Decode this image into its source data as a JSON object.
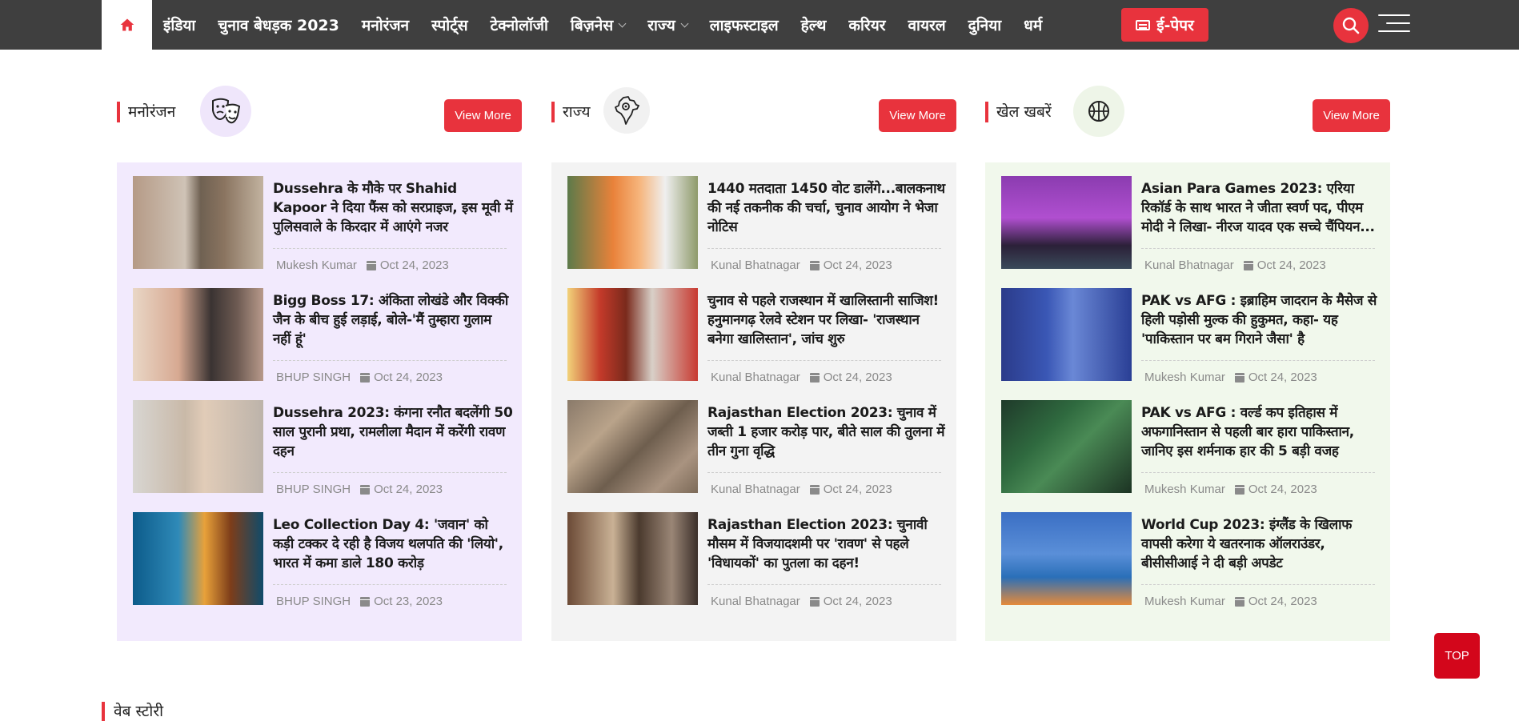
{
  "nav": {
    "items": [
      "इंडिया",
      "चुनाव बेधड़क 2023",
      "मनोरंजन",
      "स्पोर्ट्स",
      "टेक्नोलॉजी",
      "बिज़नेस",
      "राज्य",
      "लाइफस्टाइल",
      "हेल्थ",
      "करियर",
      "वायरल",
      "दुनिया",
      "धर्म"
    ],
    "dropdown_items": [
      "बिज़नेस",
      "राज्य"
    ],
    "epaper_label": "ई-पेपर",
    "accent_color": "#e8333d",
    "bar_color": "#3f3f3f"
  },
  "sections": [
    {
      "title": "मनोरंजन",
      "icon": "theater-masks-icon",
      "view_more": "View More",
      "stories": [
        {
          "headline": "Dussehra के मौके पर Shahid Kapoor ने दिया फैंस को सरप्राइज, इस मूवी में पुलिसवाले के किरदार में आएंगे नजर",
          "author": "Mukesh Kumar",
          "date": "Oct 24, 2023"
        },
        {
          "headline": "Bigg Boss 17: अंकिता लोखंडे और विक्की जैन के बीच हुई लड़ाई, बोले-'मैं तुम्हारा गुलाम नहीं हूं'",
          "author": "BHUP SINGH",
          "date": "Oct 24, 2023"
        },
        {
          "headline": "Dussehra 2023: कंगना रनौत बदलेंगी 50 साल पुरानी प्रथा, रामलीला मैदान में करेंगी रावण दहन",
          "author": "BHUP SINGH",
          "date": "Oct 24, 2023"
        },
        {
          "headline": "Leo Collection Day 4: 'जवान' को कड़ी टक्कर दे रही है विजय थलपति की 'लियो', भारत में कमा डाले 180 करोड़",
          "author": "BHUP SINGH",
          "date": "Oct 23, 2023"
        }
      ]
    },
    {
      "title": "राज्य",
      "icon": "india-map-icon",
      "view_more": "View More",
      "stories": [
        {
          "headline": "1440 मतदाता 1450 वोट डालेंगे...बालकनाथ की नई तकनीक की चर्चा, चुनाव आयोग ने भेजा नोटिस",
          "author": "Kunal Bhatnagar",
          "date": "Oct 24, 2023"
        },
        {
          "headline": "चुनाव से पहले राजस्थान में खालिस्तानी साजिश! हनुमानगढ़ रेलवे स्टेशन पर लिखा- 'राजस्थान बनेगा खालिस्तान', जांच शुरु",
          "author": "Kunal Bhatnagar",
          "date": "Oct 24, 2023"
        },
        {
          "headline": "Rajasthan Election 2023: चुनाव में जब्ती 1 हजार करोड़ पार, बीते साल की तुलना में तीन गुना वृद्धि",
          "author": "Kunal Bhatnagar",
          "date": "Oct 24, 2023"
        },
        {
          "headline": "Rajasthan Election 2023: चुनावी मौसम में विजयादशमी पर 'रावण' से पहले 'विधायकों' का पुतला का दहन!",
          "author": "Kunal Bhatnagar",
          "date": "Oct 24, 2023"
        }
      ]
    },
    {
      "title": "खेल खबरें",
      "icon": "basketball-icon",
      "view_more": "View More",
      "stories": [
        {
          "headline": "Asian Para Games 2023: एरिया रिकॉर्ड के साथ भारत ने जीता स्वर्ण पद, पीएम मोदी ने लिखा- नीरज यादव एक सच्चे चैंपियन...",
          "author": "Kunal Bhatnagar",
          "date": "Oct 24, 2023"
        },
        {
          "headline": "PAK vs AFG : इब्राहिम जादरान के मैसेज से हिली पड़ोसी मुल्क की हुकुमत, कहा- यह 'पाकिस्तान पर बम गिराने जैसा' है",
          "author": "Mukesh Kumar",
          "date": "Oct 24, 2023"
        },
        {
          "headline": "PAK vs AFG : वर्ल्ड कप इतिहास में अफगानिस्तान से पहली बार हारा पाकिस्तान, जानिए इस शर्मनाक हार की 5 बड़ी वजह",
          "author": "Mukesh Kumar",
          "date": "Oct 24, 2023"
        },
        {
          "headline": "World Cup 2023: इंग्लैंड के खिलाफ वापसी करेगा ये खतरनाक ऑलराउंडर, बीसीसीआई ने दी बड़ी अपडेट",
          "author": "Mukesh Kumar",
          "date": "Oct 24, 2023"
        }
      ]
    }
  ],
  "top_button": "TOP",
  "web_story_title": "वेब स्टोरी"
}
